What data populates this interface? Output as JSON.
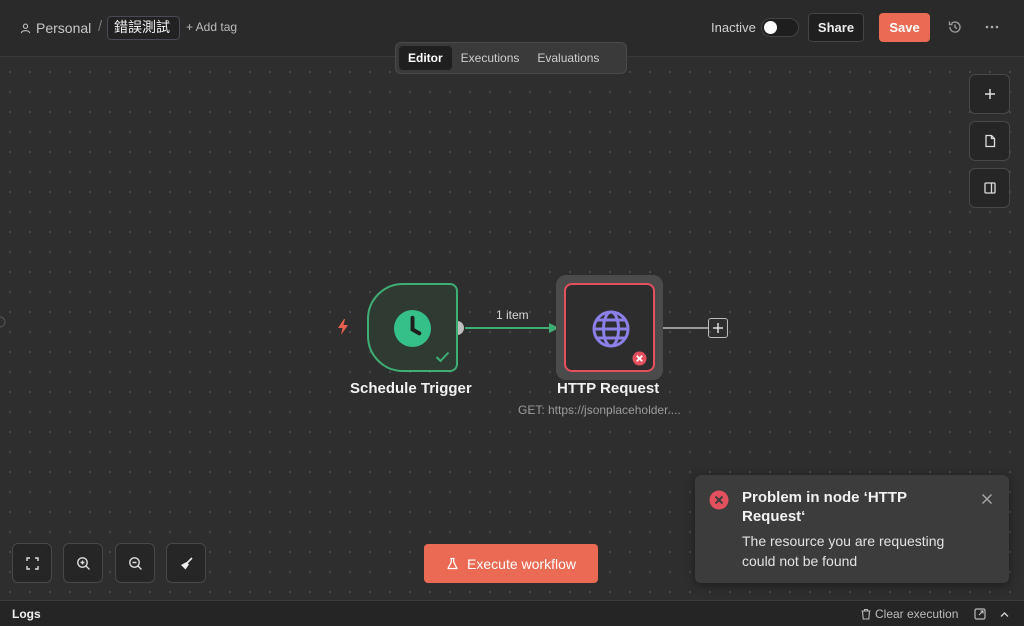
{
  "header": {
    "project": "Personal",
    "workflow_name": "錯誤測試",
    "add_tag": "+ Add tag",
    "status_label": "Inactive",
    "share_label": "Share",
    "save_label": "Save"
  },
  "tabs": [
    {
      "label": "Editor",
      "active": true
    },
    {
      "label": "Executions",
      "active": false
    },
    {
      "label": "Evaluations",
      "active": false
    }
  ],
  "canvas": {
    "edge_label": "1 item",
    "nodes": {
      "trigger": {
        "title": "Schedule Trigger",
        "status": "success",
        "icon": "clock-icon"
      },
      "http": {
        "title": "HTTP Request",
        "subtitle": "GET: https://jsonplaceholder....",
        "status": "error",
        "icon": "globe-icon"
      }
    }
  },
  "actions": {
    "execute_label": "Execute workflow"
  },
  "toast": {
    "title": "Problem in node ‘HTTP Request‘",
    "message": "The resource you are requesting could not be found"
  },
  "logs": {
    "title": "Logs",
    "clear_label": "Clear execution"
  },
  "colors": {
    "accent": "#ea6a54",
    "success": "#3fae74",
    "error": "#e5505f",
    "globe": "#8b7fe8"
  }
}
